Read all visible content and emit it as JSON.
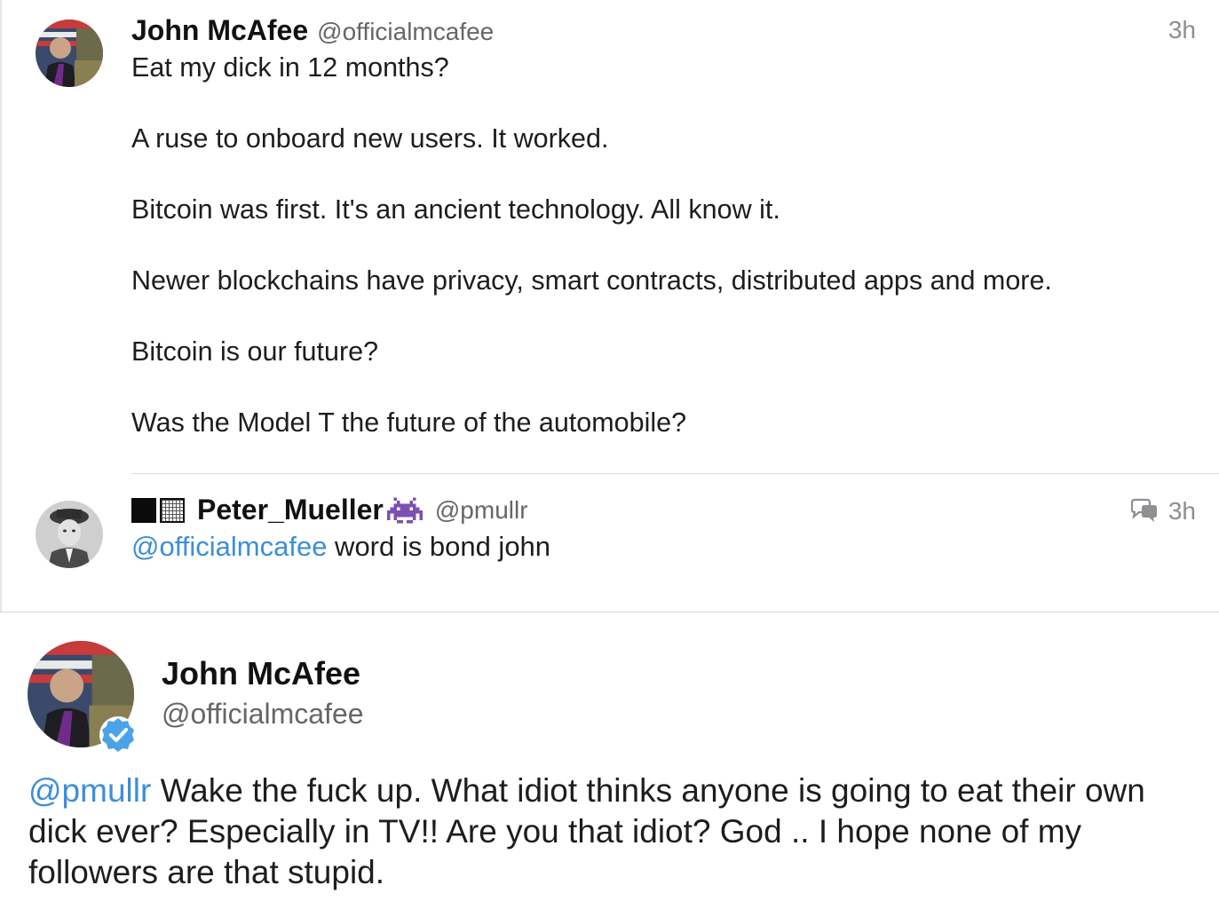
{
  "tweet1": {
    "display_name": "John McAfee",
    "handle": "@officialmcafee",
    "time": "3h",
    "text": "Eat my dick in 12 months?\n\nA ruse to onboard new users. It worked.\n\nBitcoin was first. It's an ancient technology.  All know it.\n\nNewer blockchains have privacy, smart contracts, distributed apps and more.\n\nBitcoin is our future?\n\nWas the Model T the future of the automobile?",
    "avatar_icon": "portrait-with-flag-avatar"
  },
  "tweet2": {
    "display_name": "Peter_Mueller",
    "handle": "@pmullr",
    "time": "3h",
    "name_prefix_icons": [
      "black-square-icon",
      "grid-square-icon"
    ],
    "name_suffix_icon": "alien-monster-icon",
    "conversation_icon": "conversation-icon",
    "mention": "@officialmcafee",
    "text": " word is bond john",
    "avatar_icon": "black-and-white-portrait-avatar"
  },
  "focused_tweet": {
    "display_name": "John McAfee",
    "handle": "@officialmcafee",
    "mention": "@pmullr",
    "text": " Wake the fuck up. What idiot thinks anyone is going to eat their own dick ever? Especially in TV!! Are you that idiot?  God ..  I hope none of my followers are that stupid.",
    "verified_icon": "verified-badge-icon"
  },
  "colors": {
    "link": "#3d8ed9",
    "verified": "#4aa3e8",
    "text": "#1d1d1f",
    "secondary": "#666666",
    "divider": "#dcdcdc"
  }
}
